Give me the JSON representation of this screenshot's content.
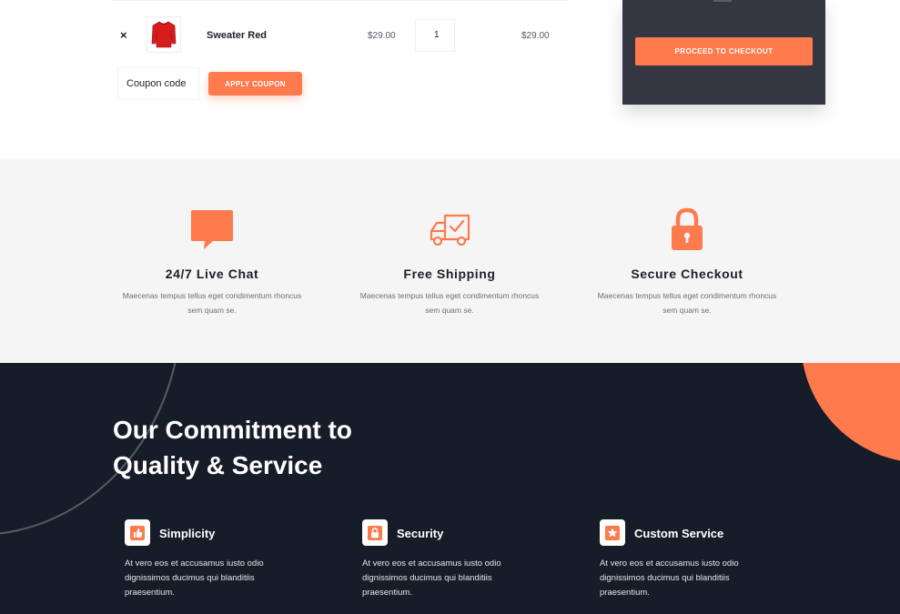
{
  "cart": {
    "remove_label": "×",
    "product_name": "Sweater Red",
    "price": "$29.00",
    "quantity": "1",
    "subtotal": "$29.00",
    "coupon_placeholder": "Coupon code",
    "apply_coupon_label": "APPLY COUPON"
  },
  "totals": {
    "checkout_label": "PROCEED TO CHECKOUT"
  },
  "features": [
    {
      "icon": "chat-bubble-icon",
      "title": "24/7 Live Chat",
      "text": "Maecenas tempus tellus eget condimentum rhoncus sem quam se."
    },
    {
      "icon": "delivery-truck-icon",
      "title": "Free Shipping",
      "text": "Maecenas tempus tellus eget condimentum rhoncus sem quam se."
    },
    {
      "icon": "padlock-icon",
      "title": "Secure Checkout",
      "text": "Maecenas tempus tellus eget condimentum rhoncus sem quam se."
    }
  ],
  "commitment": {
    "title": "Our Commitment to Quality & Service",
    "pillars": [
      {
        "icon": "thumbs-up-icon",
        "title": "Simplicity",
        "text": "At vero eos et accusamus iusto odio dignissimos ducimus qui blanditiis praesentium."
      },
      {
        "icon": "lock-icon",
        "title": "Security",
        "text": "At vero eos et accusamus iusto odio dignissimos ducimus qui blanditiis praesentium."
      },
      {
        "icon": "star-badge-icon",
        "title": "Custom Service",
        "text": "At vero eos et accusamus iusto odio dignissimos ducimus qui blanditiis praesentium."
      }
    ]
  },
  "colors": {
    "accent": "#ff7a4c",
    "dark_bg": "#171c29",
    "card_bg": "#343642",
    "light_bg": "#f5f5f5"
  }
}
